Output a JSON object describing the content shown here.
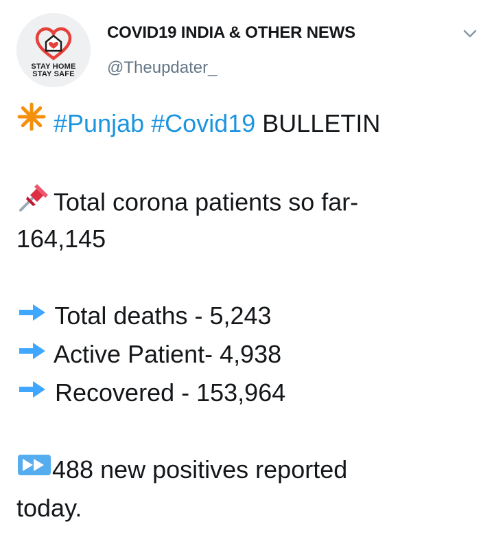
{
  "account": {
    "display_name": "COVID19 INDIA & OTHER NEWS",
    "handle": "@Theupdater_",
    "avatar_text_line1": "STAY HOME",
    "avatar_text_line2": "STAY SAFE",
    "avatar_icon": "heart-house-icon"
  },
  "tweet": {
    "bulletin_icon": "eight-spoked-asterisk-icon",
    "hashtag_1": "#Punjab",
    "hashtag_2": "#Covid19",
    "bulletin_word": "BULLETIN",
    "pin_icon": "pushpin-icon",
    "total_patients_label": "Total corona patients so far-",
    "total_patients_value": "164,145",
    "arrow_icon": "right-arrow-icon",
    "deaths": "Total deaths - 5,243",
    "active": "Active Patient- 4,938",
    "recovered": "Recovered - 153,964",
    "fast_forward_icon": "fast-forward-icon",
    "new_positives_line1": "488 new positives reported",
    "new_positives_line2": "today."
  },
  "colors": {
    "hashtag": "#1b95e0",
    "handle": "#657786",
    "text": "#14171a",
    "arrow": "#3fa7ff",
    "asterisk": "#f4900c",
    "pin": "#e8594c"
  }
}
